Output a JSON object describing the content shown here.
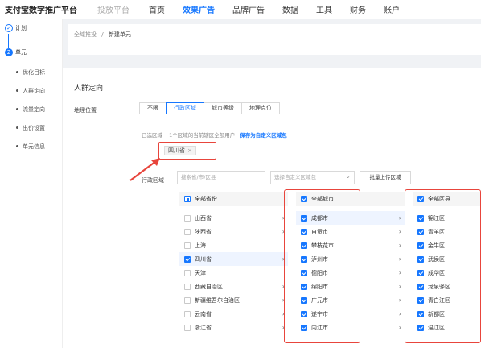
{
  "topbar": {
    "brand": "支付宝数字推广平台",
    "brand2": "投放平台",
    "nav": [
      "首页",
      "效果广告",
      "品牌广告",
      "数据",
      "工具",
      "财务",
      "账户"
    ],
    "active_index": 1
  },
  "steps": {
    "step1": "计划",
    "step2_num": "2",
    "step2": "单元",
    "sub_items": [
      "优化目标",
      "人群定向",
      "流量定向",
      "出价设置",
      "单元信息"
    ]
  },
  "breadcrumb": {
    "parent": "全域推投",
    "sep": "/",
    "current": "新建单元"
  },
  "section": {
    "title": "人群定向",
    "geo_label": "地理位置",
    "geo_tabs": [
      "不限",
      "行政区域",
      "城市等级",
      "地理点位"
    ],
    "geo_active": 1,
    "selected_prefix": "已选区域",
    "selected_text": "1个区域的当前辖区全部用户",
    "save_link": "保存为自定义区域包",
    "tag": "四川省",
    "tag_close": "×"
  },
  "admin": {
    "label": "行政区域",
    "search_placeholder": "搜索省/市/区县",
    "custom_placeholder": "选择自定义区域包",
    "batch_button": "批量上传区域"
  },
  "provinces": {
    "header": "全部省份",
    "items": [
      "山西省",
      "陕西省",
      "上海",
      "四川省",
      "天津",
      "西藏自治区",
      "新疆维吾尔自治区",
      "云南省",
      "浙江省"
    ],
    "checked": [
      false,
      false,
      false,
      true,
      false,
      false,
      false,
      false,
      false
    ]
  },
  "cities": {
    "header": "全部城市",
    "items": [
      "成都市",
      "自贡市",
      "攀枝花市",
      "泸州市",
      "德阳市",
      "绵阳市",
      "广元市",
      "遂宁市",
      "内江市"
    ]
  },
  "districts": {
    "header": "全部区县",
    "items": [
      "锦江区",
      "青羊区",
      "金牛区",
      "武侯区",
      "成华区",
      "龙泉驿区",
      "青白江区",
      "新都区",
      "温江区"
    ]
  },
  "colors": {
    "accent": "#1677ff",
    "annotation": "#e8453c"
  }
}
